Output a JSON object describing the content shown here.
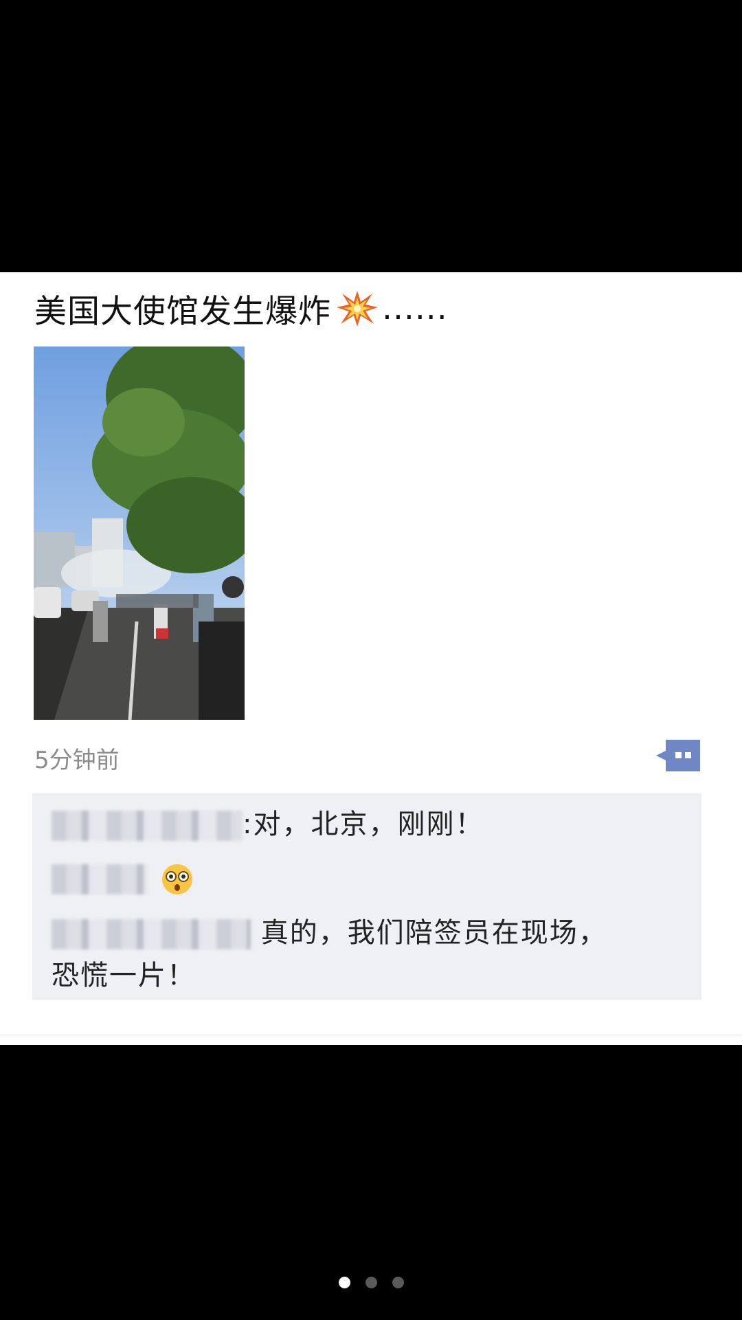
{
  "post": {
    "text": "美国大使馆发生爆炸",
    "emoji_icon": "collision-burst-icon",
    "ellipsis": "......",
    "timestamp": "5分钟前"
  },
  "comment_button": {
    "icon": "comment-dots-icon",
    "color": "#6f87c4"
  },
  "comments": [
    {
      "separator": ":",
      "text": "对，北京，刚刚！"
    },
    {
      "emoji": "astonished-face-icon"
    },
    {
      "text": "真的，我们陪签员在现场，",
      "text_cont": "恐慌一片！"
    }
  ],
  "pager": {
    "pages": 3,
    "active_index": 0
  },
  "colors": {
    "background": "#000000",
    "card": "#ffffff",
    "comment_panel": "#eef0f4",
    "timestamp": "#8b8b8b"
  }
}
